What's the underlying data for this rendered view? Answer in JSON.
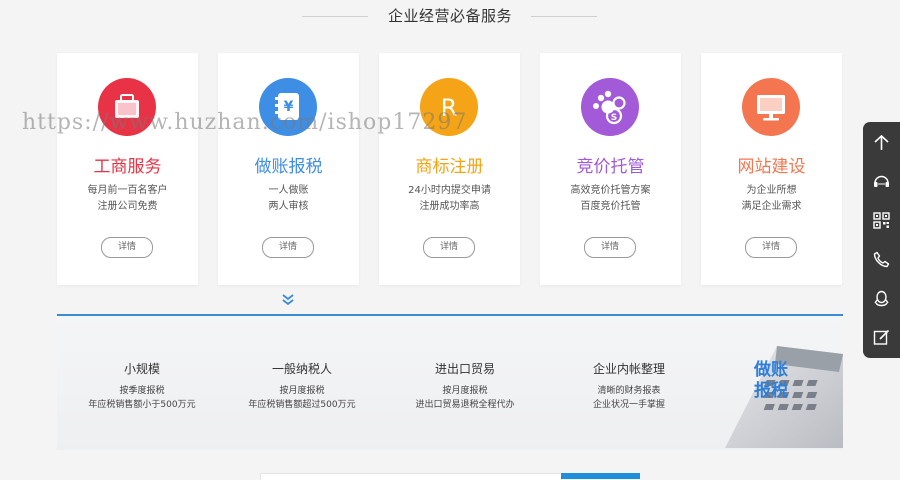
{
  "section": {
    "title": "企业经营必备服务"
  },
  "cards": [
    {
      "title": "工商服务",
      "desc1": "每月前一百名客户",
      "desc2": "注册公司免费",
      "button": "详情",
      "color": "#e83346",
      "icon": "briefcase-icon"
    },
    {
      "title": "做账报税",
      "desc1": "一人做账",
      "desc2": "两人审核",
      "button": "详情",
      "color": "#3f8ee6",
      "icon": "ledger-icon"
    },
    {
      "title": "商标注册",
      "desc1": "24小时内提交申请",
      "desc2": "注册成功率高",
      "button": "详情",
      "color": "#f4a416",
      "icon": "registered-icon"
    },
    {
      "title": "竞价托管",
      "desc1": "高效竞价托管方案",
      "desc2": "百度竞价托管",
      "button": "详情",
      "color": "#a25ad8",
      "icon": "baidu-paw-icon"
    },
    {
      "title": "网站建设",
      "desc1": "为企业所想",
      "desc2": "满足企业需求",
      "button": "详情",
      "color": "#f47650",
      "icon": "monitor-icon"
    }
  ],
  "panel": {
    "columns": [
      {
        "heading": "小规模",
        "line1": "按季度报税",
        "line2": "年应税销售额小于500万元"
      },
      {
        "heading": "一般纳税人",
        "line1": "按月度报税",
        "line2": "年应税销售额超过500万元"
      },
      {
        "heading": "进出口贸易",
        "line1": "按月度报税",
        "line2": "进出口贸易退税全程代办"
      },
      {
        "heading": "企业内帐整理",
        "line1": "清晰的财务报表",
        "line2": "企业状况一手掌握"
      }
    ],
    "image_text": "做账报税"
  },
  "toolbar": {
    "items": [
      "arrow-up-icon",
      "headset-icon",
      "qrcode-icon",
      "phone-icon",
      "qq-icon",
      "edit-icon"
    ]
  },
  "watermark": "https://www.huzhan.com/ishop17297"
}
